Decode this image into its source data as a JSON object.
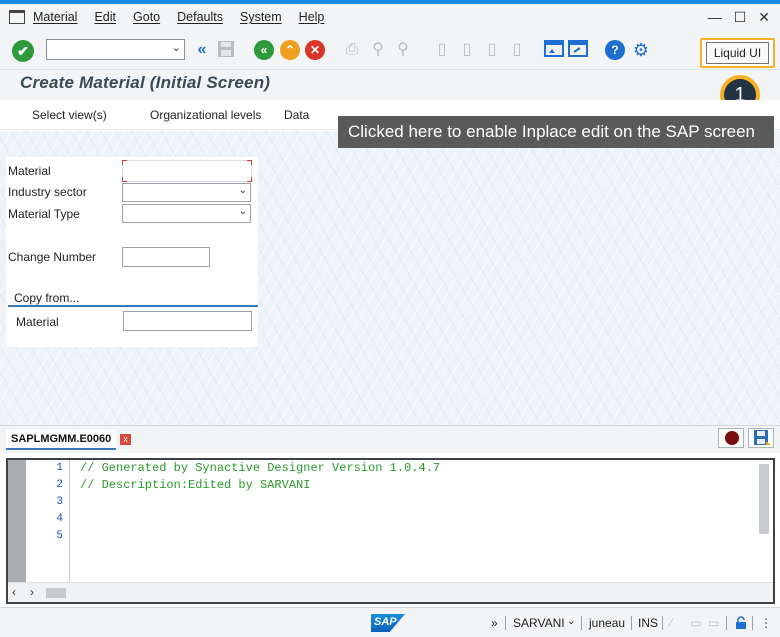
{
  "menu": {
    "items": [
      "Material",
      "Edit",
      "Goto",
      "Defaults",
      "System",
      "Help"
    ]
  },
  "window_controls": {
    "minimize": "—",
    "maximize": "☐",
    "close": "✕"
  },
  "toolbar": {
    "command_field_value": "",
    "liquid_ui_label": "Liquid UI"
  },
  "screen": {
    "title": "Create Material (Initial Screen)"
  },
  "appbar": {
    "buttons": [
      "Select view(s)",
      "Organizational levels",
      "Data"
    ]
  },
  "callout": {
    "step_number": "1",
    "text": "Clicked here to enable Inplace edit on the SAP screen"
  },
  "form": {
    "material_label": "Material",
    "material_value": "",
    "industry_sector_label": "Industry sector",
    "industry_sector_value": "",
    "material_type_label": "Material Type",
    "material_type_value": "",
    "change_number_label": "Change Number",
    "change_number_value": ""
  },
  "copy_from": {
    "heading": "Copy from...",
    "material_label": "Material",
    "material_value": ""
  },
  "editor": {
    "tab_label": "SAPLMGMM.E0060",
    "tab_close": "x",
    "line_numbers": [
      "1",
      "2",
      "3",
      "4",
      "5"
    ],
    "lines": [
      "// Generated by Synactive Designer Version 1.0.4.7",
      "// Description:Edited by SARVANI",
      "",
      "",
      ""
    ]
  },
  "status": {
    "logo_text": "SAP",
    "expand": "»",
    "user": "SARVANI",
    "server": "juneau",
    "mode": "INS"
  },
  "colors": {
    "accent_blue": "#1e88e5",
    "highlight_orange": "#f5b024",
    "ok_green": "#2e9a3c",
    "code_comment_green": "#2a9a2a",
    "line_number_blue": "#1a4fbf",
    "required_red": "#d13a3a"
  }
}
